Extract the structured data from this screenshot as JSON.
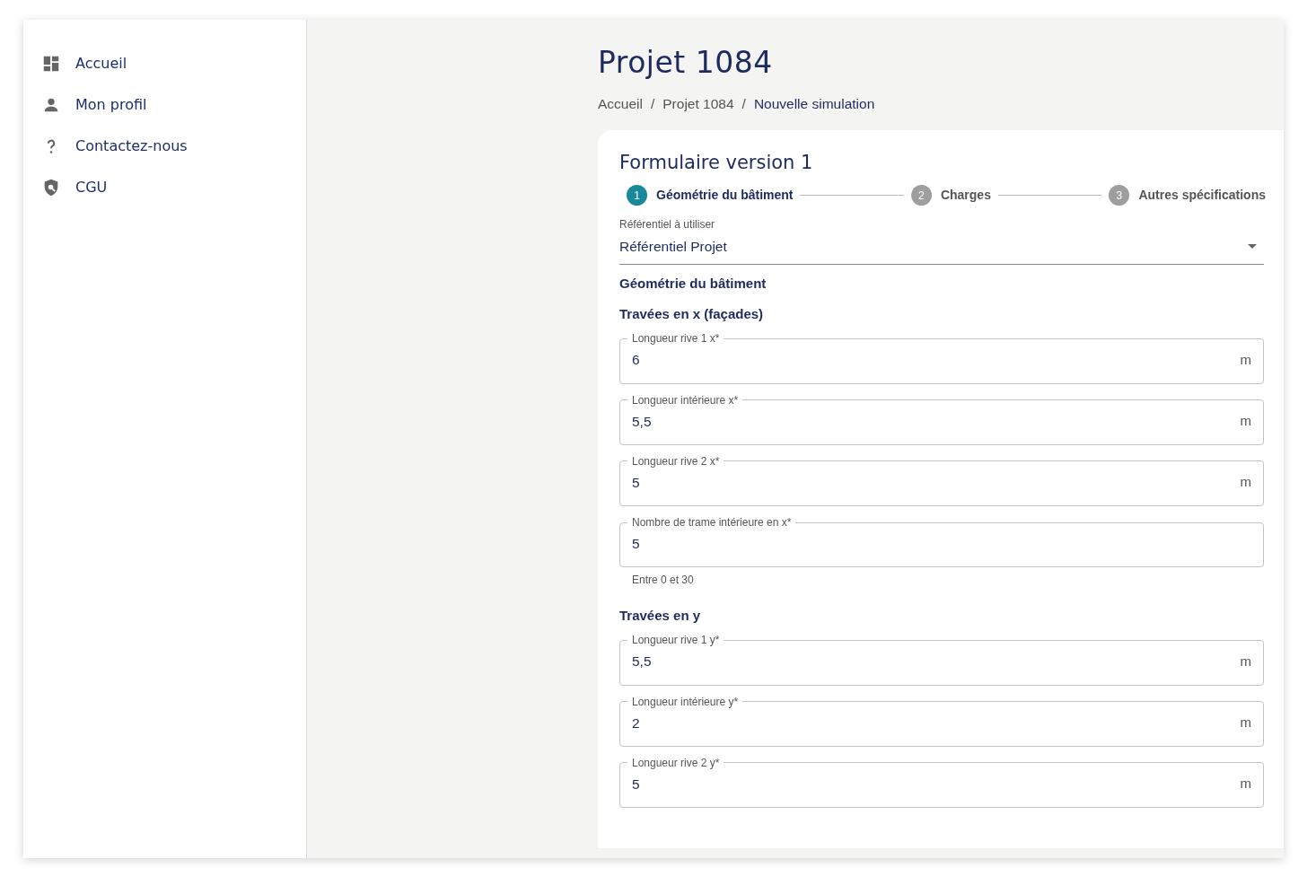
{
  "sidebar": {
    "items": [
      {
        "label": "Accueil"
      },
      {
        "label": "Mon profil"
      },
      {
        "label": "Contactez-nous"
      },
      {
        "label": "CGU"
      }
    ]
  },
  "page_title": "Projet 1084",
  "breadcrumb": [
    {
      "label": "Accueil",
      "current": false
    },
    {
      "label": "Projet 1084",
      "current": false
    },
    {
      "label": "Nouvelle simulation",
      "current": true
    }
  ],
  "breadcrumb_separator": "/",
  "form": {
    "title": "Formulaire version 1",
    "steps": [
      {
        "number": "1",
        "label": "Géométrie du bâtiment",
        "selected": true
      },
      {
        "number": "2",
        "label": "Charges",
        "selected": false
      },
      {
        "number": "3",
        "label": "Autres spécifications",
        "selected": false
      }
    ],
    "select": {
      "label": "Référentiel à utiliser",
      "value": "Référentiel Projet"
    },
    "section_title": "Géométrie du bâtiment",
    "groups": [
      {
        "title": "Travées en x (façades)",
        "fields": [
          {
            "label": "Longueur rive 1 x*",
            "value": "6",
            "unit": "m"
          },
          {
            "label": "Longueur intérieure x*",
            "value": "5,5",
            "unit": "m"
          },
          {
            "label": "Longueur rive 2 x*",
            "value": "5",
            "unit": "m"
          },
          {
            "label": "Nombre de trame intérieure en x*",
            "value": "5",
            "hint": "Entre 0 et 30"
          }
        ]
      },
      {
        "title": "Travées en y",
        "fields": [
          {
            "label": "Longueur rive 1 y*",
            "value": "5,5",
            "unit": "m"
          },
          {
            "label": "Longueur intérieure y*",
            "value": "2",
            "unit": "m"
          },
          {
            "label": "Longueur rive 2 y*",
            "value": "5",
            "unit": "m"
          }
        ]
      }
    ]
  }
}
